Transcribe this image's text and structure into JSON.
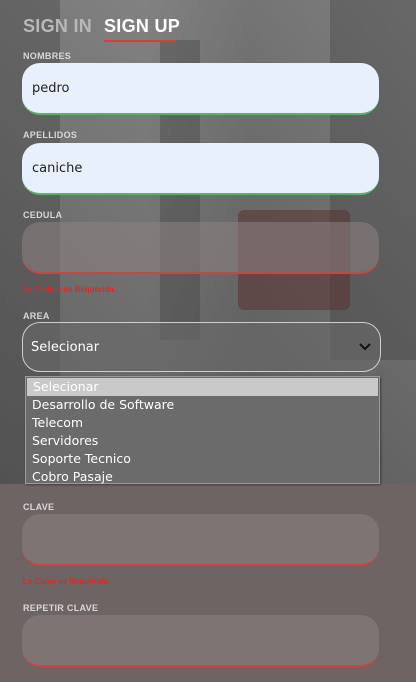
{
  "tabs": {
    "signin": "SIGN IN",
    "signup": "SIGN UP"
  },
  "form": {
    "nombres": {
      "label": "NOMBRES",
      "value": "pedro"
    },
    "apellidos": {
      "label": "APELLIDOS",
      "value": "caniche"
    },
    "cedula": {
      "label": "CEDULA",
      "value": "",
      "error": "La Cedula es Requerida."
    },
    "area": {
      "label": "AREA",
      "selected": "Selecionar",
      "options": [
        "Selecionar",
        "Desarrollo de Software",
        "Telecom",
        "Servidores",
        "Soporte Tecnico",
        "Cobro Pasaje"
      ]
    },
    "clave": {
      "label": "CLAVE",
      "value": "",
      "error": "La Clave es Requerida."
    },
    "repetir_clave": {
      "label": "REPETIR CLAVE",
      "value": ""
    }
  },
  "colors": {
    "accent": "#e0383b",
    "error": "#e52525",
    "valid": "#58b36b"
  },
  "icons": {
    "select_arrow": "chevron-down-icon"
  }
}
